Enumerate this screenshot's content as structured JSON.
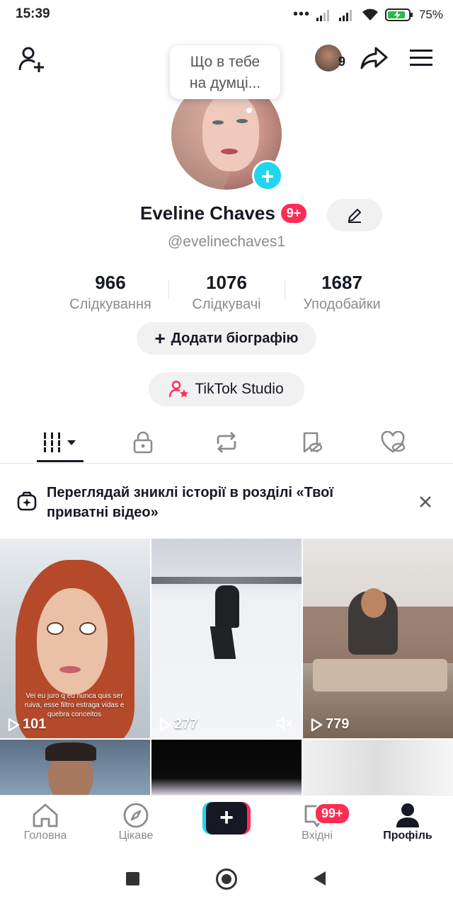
{
  "status_bar": {
    "time": "15:39",
    "battery": "75%"
  },
  "header": {
    "friends_count": "9"
  },
  "bubble": {
    "line1": "Що в тебе",
    "line2": "на думці..."
  },
  "profile": {
    "name": "Eveline Chaves",
    "name_badge": "9+",
    "handle": "@evelinechaves1"
  },
  "stats": [
    {
      "value": "966",
      "label": "Слідкування"
    },
    {
      "value": "1076",
      "label": "Слідкувачі"
    },
    {
      "value": "1687",
      "label": "Уподобайки"
    }
  ],
  "buttons": {
    "add_bio": "Додати біографію",
    "studio": "TikTok Studio"
  },
  "banner": {
    "text": "Переглядай зниклі історії в розділі «Твої приватні відео»"
  },
  "videos": [
    {
      "views": "101",
      "caption": "Vei eu juro q eu nunca quis ser ruiva, esse filtro estraga vidas e quebra conceitos"
    },
    {
      "views": "277"
    },
    {
      "views": "779"
    }
  ],
  "bottom_nav": {
    "home": "Головна",
    "discover": "Цікаве",
    "inbox": "Вхідні",
    "inbox_badge": "99+",
    "profile": "Профіль"
  },
  "colors": {
    "accent_red": "#fe2c55",
    "accent_cyan": "#20d5ec",
    "text": "#161823",
    "muted": "#8a8b91"
  }
}
